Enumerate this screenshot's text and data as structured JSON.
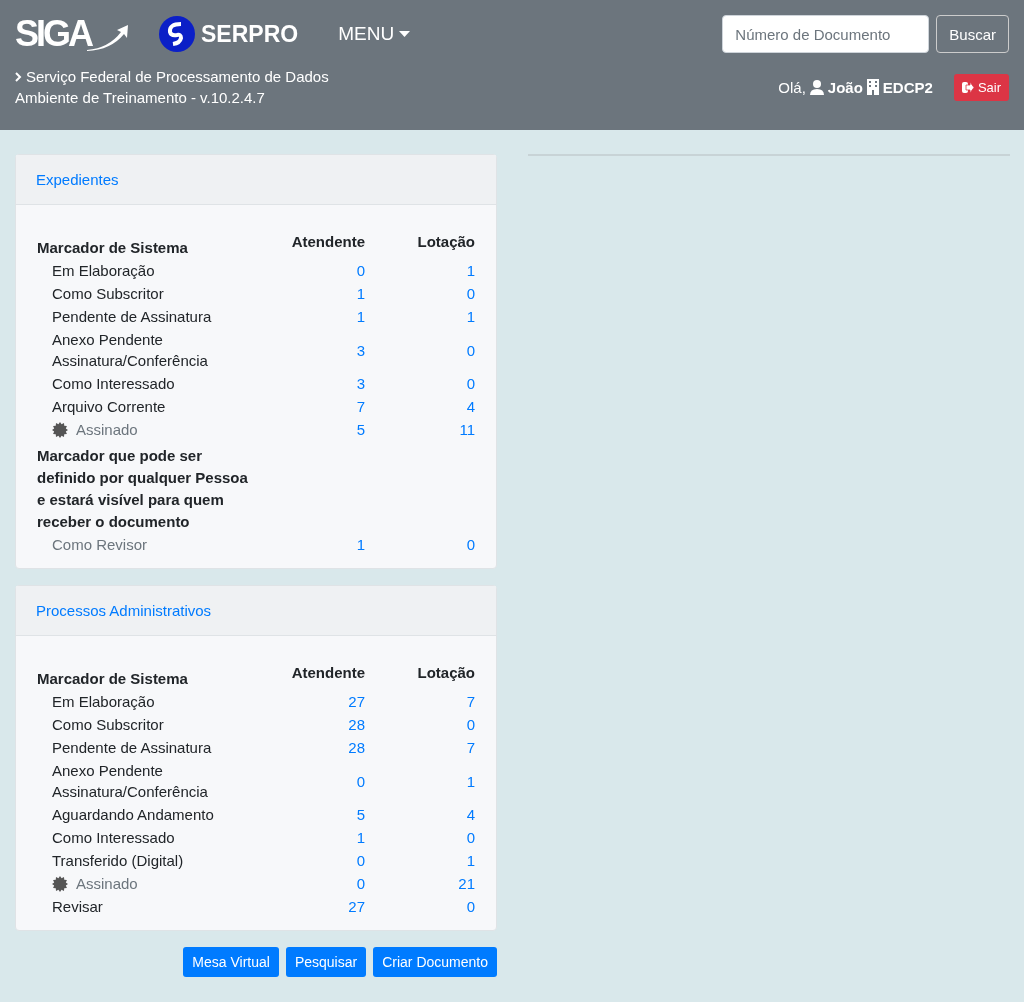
{
  "header": {
    "app_logo": "SIGA",
    "org_logo": "SERPRO",
    "menu": "MENU",
    "search": {
      "placeholder": "Número de Documento"
    },
    "search_button": "Buscar",
    "org_name": "Serviço Federal de Processamento de Dados",
    "environment": "Ambiente de Treinamento - v.10.2.4.7",
    "greeting": "Olá,",
    "user": "João",
    "unit": "EDCP2",
    "logout": "Sair"
  },
  "panels": [
    {
      "title": "Expedientes",
      "columns": [
        "Atendente",
        "Lotação"
      ],
      "groups": [
        {
          "heading": "Marcador de Sistema",
          "rows": [
            {
              "label": "Em Elaboração",
              "kind": "plain",
              "atendente": "0",
              "lotacao": "1"
            },
            {
              "label": "Como Subscritor",
              "kind": "plain",
              "atendente": "1",
              "lotacao": "0"
            },
            {
              "label": "Pendente de Assinatura",
              "kind": "plain",
              "atendente": "1",
              "lotacao": "1"
            },
            {
              "label": "Anexo Pendente Assinatura/Conferência",
              "kind": "plain",
              "atendente": "3",
              "lotacao": "0"
            },
            {
              "label": "Como Interessado",
              "kind": "plain",
              "atendente": "3",
              "lotacao": "0"
            },
            {
              "label": "Arquivo Corrente",
              "kind": "plain",
              "atendente": "7",
              "lotacao": "4"
            },
            {
              "label": "Assinado",
              "kind": "sealed",
              "atendente": "5",
              "lotacao": "11"
            }
          ]
        },
        {
          "heading": "Marcador que pode ser definido por qualquer Pessoa e estará visível para quem receber o documento",
          "rows": [
            {
              "label": "Como Revisor",
              "kind": "muted",
              "atendente": "1",
              "lotacao": "0"
            }
          ]
        }
      ]
    },
    {
      "title": "Processos Administrativos",
      "columns": [
        "Atendente",
        "Lotação"
      ],
      "groups": [
        {
          "heading": "Marcador de Sistema",
          "rows": [
            {
              "label": "Em Elaboração",
              "kind": "plain",
              "atendente": "27",
              "lotacao": "7"
            },
            {
              "label": "Como Subscritor",
              "kind": "plain",
              "atendente": "28",
              "lotacao": "0"
            },
            {
              "label": "Pendente de Assinatura",
              "kind": "plain",
              "atendente": "28",
              "lotacao": "7"
            },
            {
              "label": "Anexo Pendente Assinatura/Conferência",
              "kind": "plain",
              "atendente": "0",
              "lotacao": "1"
            },
            {
              "label": "Aguardando Andamento",
              "kind": "plain",
              "atendente": "5",
              "lotacao": "4"
            },
            {
              "label": "Como Interessado",
              "kind": "plain",
              "atendente": "1",
              "lotacao": "0"
            },
            {
              "label": "Transferido (Digital)",
              "kind": "plain",
              "atendente": "0",
              "lotacao": "1"
            },
            {
              "label": "Assinado",
              "kind": "sealed",
              "atendente": "0",
              "lotacao": "21"
            },
            {
              "label": "Revisar",
              "kind": "plain",
              "atendente": "27",
              "lotacao": "0"
            }
          ]
        }
      ]
    }
  ],
  "actions": [
    "Mesa Virtual",
    "Pesquisar",
    "Criar Documento"
  ]
}
